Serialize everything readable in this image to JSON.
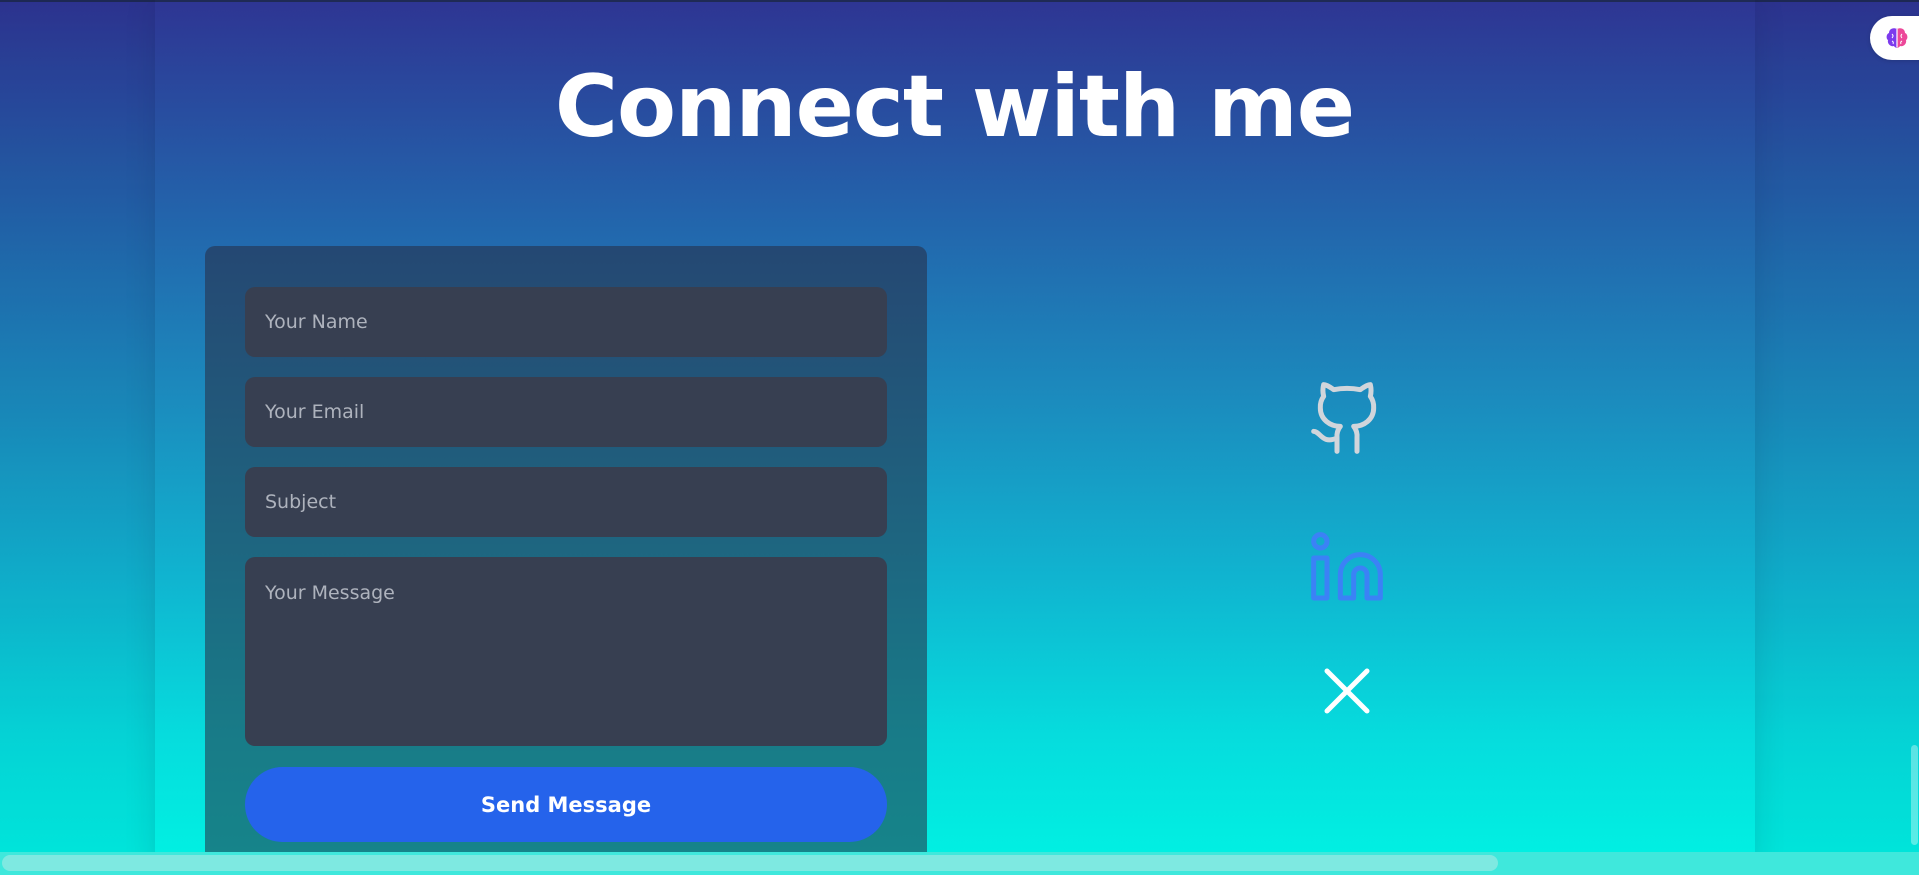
{
  "page": {
    "title": "Connect with me"
  },
  "form": {
    "name_placeholder": "Your Name",
    "email_placeholder": "Your Email",
    "subject_placeholder": "Subject",
    "message_placeholder": "Your Message",
    "send_label": "Send Message"
  },
  "social": {
    "links": [
      {
        "icon": "github-icon",
        "color": "#d1d5db"
      },
      {
        "icon": "linkedin-icon",
        "color": "#3b82f6"
      },
      {
        "icon": "x-icon",
        "color": "#ffffff"
      }
    ]
  },
  "browser_extension": {
    "icon": "brain-icon"
  },
  "colors": {
    "accent": "#2563eb",
    "field_bg": "#373f51",
    "gradient_top": "#2e3593",
    "gradient_bottom": "#00f3e3"
  }
}
